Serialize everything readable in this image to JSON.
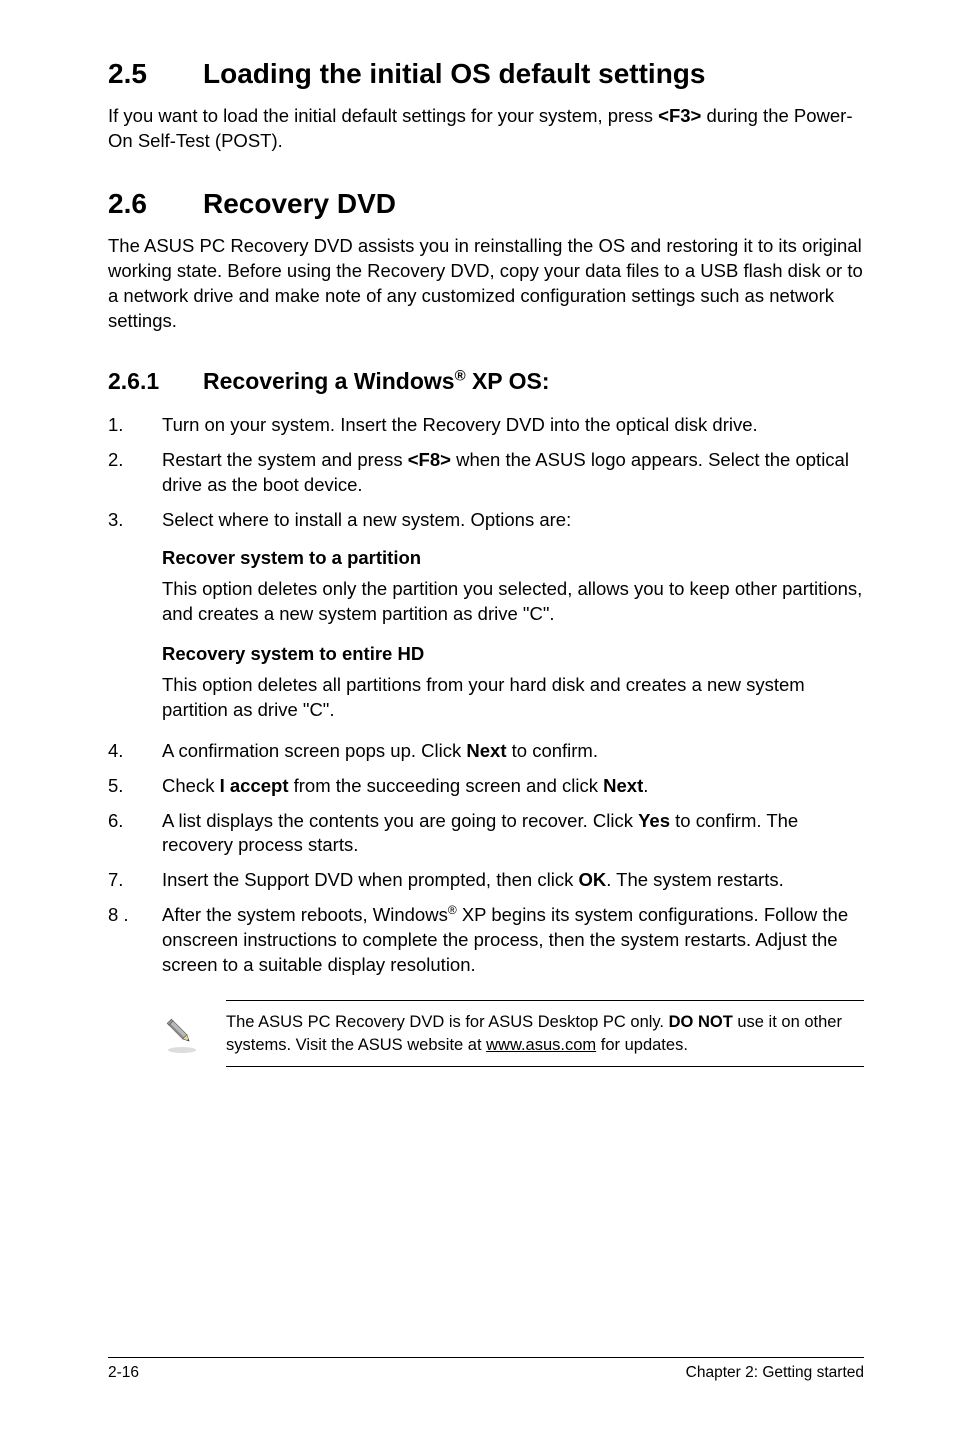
{
  "section25": {
    "number": "2.5",
    "title": "Loading the initial OS default settings",
    "body_pre": "If you want to load the initial default settings for your system, press ",
    "body_key": "<F3>",
    "body_post": " during the Power-On Self-Test (POST)."
  },
  "section26": {
    "number": "2.6",
    "title": "Recovery DVD",
    "body": "The ASUS PC Recovery DVD assists you in reinstalling the OS and restoring it to its original working state. Before using the Recovery DVD, copy your data files to a USB flash disk or to a network drive and make note of any customized configuration settings such as network settings."
  },
  "section261": {
    "number": "2.6.1",
    "title_pre": "Recovering a Windows",
    "title_sup": "®",
    "title_post": " XP OS:"
  },
  "steps_a": [
    {
      "n": "1.",
      "text": "Turn on your system. Insert the Recovery DVD into the optical disk drive."
    },
    {
      "n": "2.",
      "pre": "Restart the system and press ",
      "bold": "<F8>",
      "post": " when the ASUS logo appears. Select the optical drive as the boot device."
    },
    {
      "n": "3.",
      "text": "Select where to install a new system. Options are:"
    }
  ],
  "options": [
    {
      "heading": "Recover system to a partition",
      "text": "This option deletes only the partition you selected, allows you to keep other partitions, and creates a new system partition as drive \"C\"."
    },
    {
      "heading": "Recovery system to entire HD",
      "text": "This option deletes all partitions from your hard disk and creates a new system partition as drive \"C\"."
    }
  ],
  "steps_b": [
    {
      "n": "4.",
      "pre": "A confirmation screen pops up. Click ",
      "bold": "Next",
      "post": " to confirm."
    },
    {
      "n": "5.",
      "pre": "Check ",
      "bold": "I accept",
      "mid": " from the succeeding screen and click ",
      "bold2": "Next",
      "post": "."
    },
    {
      "n": "6.",
      "pre": "A list displays the contents you are going to recover. Click ",
      "bold": "Yes",
      "post": " to confirm. The recovery process starts."
    },
    {
      "n": "7.",
      "pre": "Insert the Support DVD when prompted, then click ",
      "bold": "OK",
      "post": ". The system restarts."
    },
    {
      "n": "8 .",
      "pre": "After the system reboots, Windows",
      "sup": "®",
      "post": " XP begins its system configurations. Follow the onscreen instructions to complete the process, then the system restarts. Adjust the screen to a suitable display resolution."
    }
  ],
  "note": {
    "pre": "The ASUS PC Recovery DVD is for ASUS Desktop PC only. ",
    "bold": "DO NOT",
    "mid": " use it on other systems. Visit the ASUS website at ",
    "link": "www.asus.com",
    "post": " for updates."
  },
  "footer": {
    "left": "2-16",
    "right": "Chapter 2: Getting started"
  }
}
